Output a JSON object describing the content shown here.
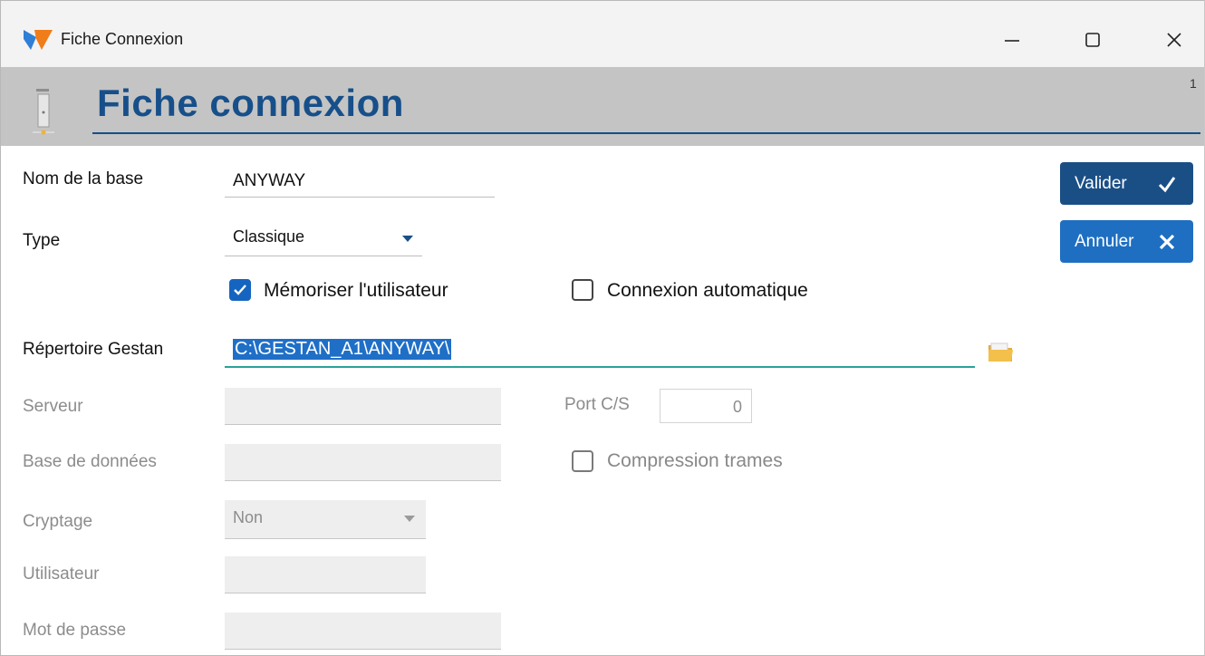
{
  "window": {
    "title": "Fiche Connexion"
  },
  "header": {
    "title": "Fiche connexion",
    "page_number": "1"
  },
  "form": {
    "nom_base": {
      "label": "Nom de la base",
      "value": "ANYWAY"
    },
    "type": {
      "label": "Type",
      "value": "Classique"
    },
    "memoriser": {
      "label": "Mémoriser l'utilisateur",
      "checked": true
    },
    "connexion_auto": {
      "label": "Connexion automatique",
      "checked": false
    },
    "repertoire": {
      "label": "Répertoire Gestan",
      "value": "C:\\GESTAN_A1\\ANYWAY\\"
    },
    "serveur": {
      "label": "Serveur",
      "value": ""
    },
    "port": {
      "label": "Port C/S",
      "value": "0"
    },
    "base_donnees": {
      "label": "Base de données",
      "value": ""
    },
    "compression": {
      "label": "Compression trames",
      "checked": false
    },
    "cryptage": {
      "label": "Cryptage",
      "value": "Non"
    },
    "utilisateur": {
      "label": "Utilisateur",
      "value": ""
    },
    "mot_de_passe": {
      "label": "Mot de passe",
      "value": ""
    }
  },
  "buttons": {
    "valider": "Valider",
    "annuler": "Annuler"
  },
  "icons": {
    "app": "app-logo-icon",
    "header": "server-icon",
    "browse": "folder-icon",
    "minimize": "minimize-icon",
    "maximize": "maximize-icon",
    "close": "close-icon",
    "valider": "checkmark-icon",
    "annuler": "x-icon"
  },
  "colors": {
    "header_title": "#174f8a",
    "valider_bg": "#1a4f86",
    "annuler_bg": "#1e6fc2",
    "selection": "#1f6fc7",
    "active_underline": "#2aa198"
  }
}
